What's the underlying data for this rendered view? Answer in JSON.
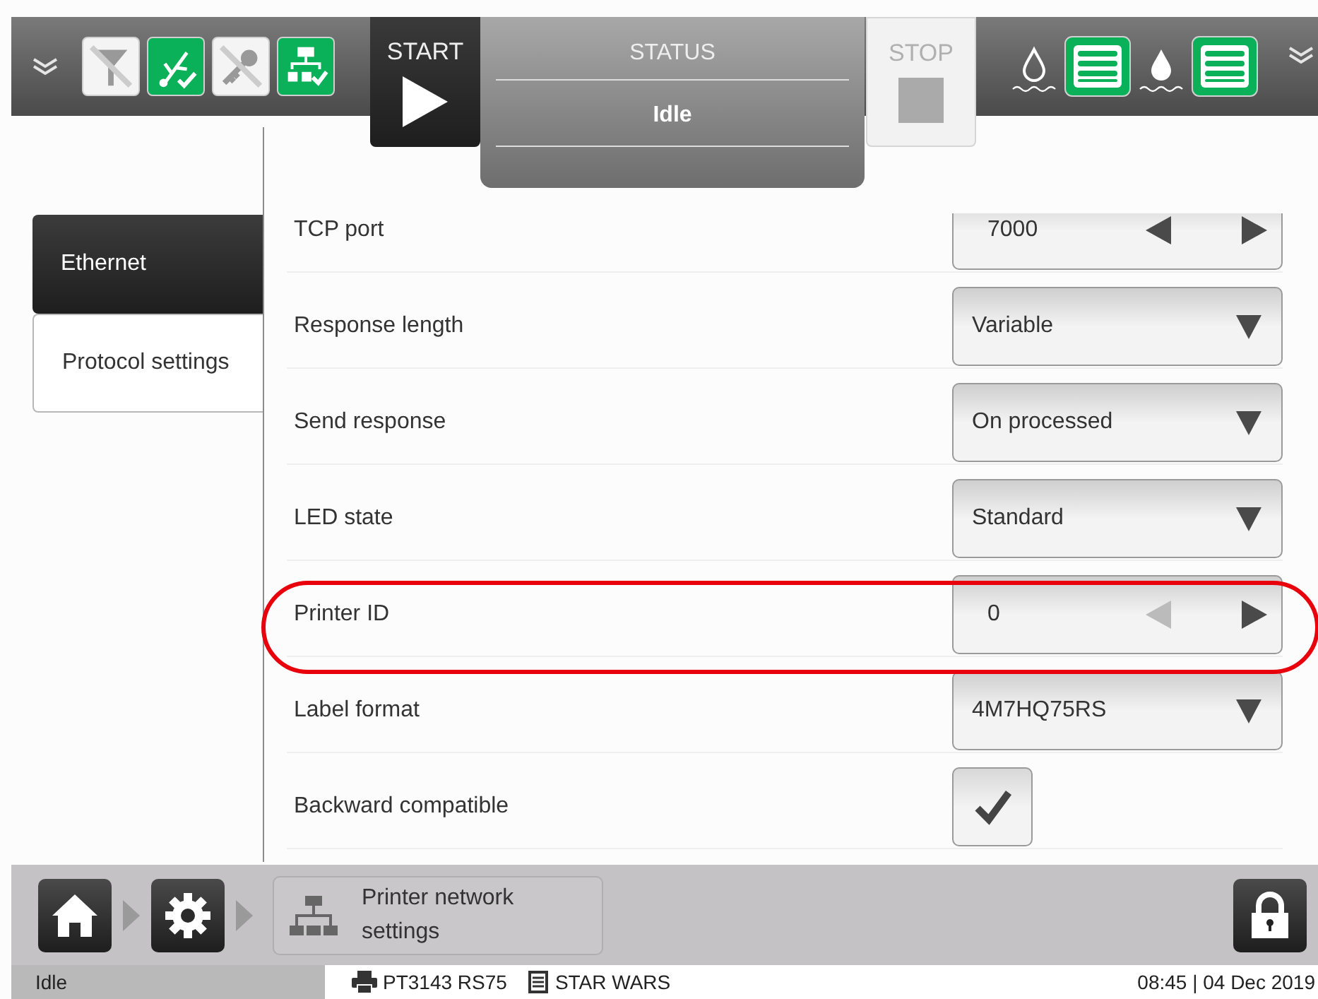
{
  "header": {
    "status_icons": [
      {
        "kind": "filter",
        "active": false
      },
      {
        "kind": "usb",
        "active": true
      },
      {
        "kind": "key",
        "active": false
      },
      {
        "kind": "network",
        "active": true
      }
    ],
    "start_label": "START",
    "status_label": "STATUS",
    "status_value": "Idle",
    "stop_label": "STOP",
    "stop_disabled": true,
    "ink_icons": [
      {
        "kind": "ink"
      },
      {
        "kind": "solvent"
      }
    ]
  },
  "sidebar": {
    "tabs": [
      {
        "label": "Ethernet",
        "selected": true
      },
      {
        "label": "Protocol settings",
        "selected": false
      }
    ]
  },
  "settings": [
    {
      "label": "TCP port",
      "kind": "stepper",
      "value": "7000",
      "prev_disabled": false,
      "next_disabled": false,
      "highlighted": false
    },
    {
      "label": "Response length",
      "kind": "dropdown",
      "value": "Variable",
      "highlighted": false
    },
    {
      "label": "Send response",
      "kind": "dropdown",
      "value": "On processed",
      "highlighted": false
    },
    {
      "label": "LED state",
      "kind": "dropdown",
      "value": "Standard",
      "highlighted": false
    },
    {
      "label": "Printer ID",
      "kind": "stepper",
      "value": "0",
      "prev_disabled": true,
      "next_disabled": false,
      "highlighted": true
    },
    {
      "label": "Label format",
      "kind": "dropdown",
      "value": "4M7HQ75RS",
      "highlighted": false
    },
    {
      "label": "Backward compatible",
      "kind": "checkbox",
      "checked": true,
      "highlighted": false
    }
  ],
  "breadcrumb": {
    "label": "Printer network settings"
  },
  "status_bar": {
    "state": "Idle",
    "printer": "PT3143 RS75",
    "job": "STAR WARS",
    "datetime": "08:45 | 04 Dec 2019"
  }
}
